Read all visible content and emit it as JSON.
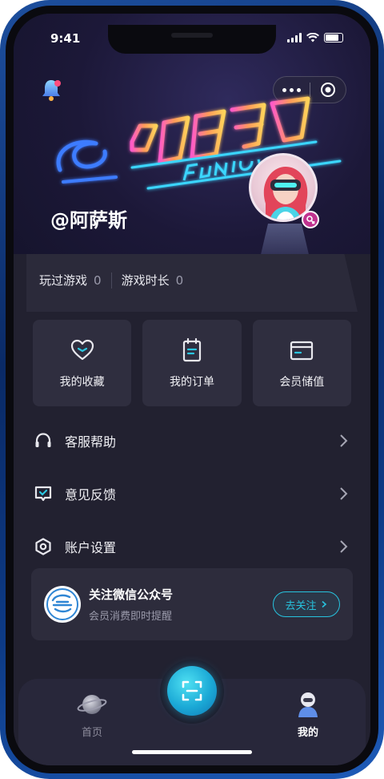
{
  "status_bar": {
    "time": "9:41"
  },
  "profile": {
    "username": "@阿萨斯"
  },
  "stats": [
    {
      "label": "玩过游戏",
      "value": "0"
    },
    {
      "label": "游戏时长",
      "value": "0"
    }
  ],
  "quick_actions": [
    {
      "label": "我的收藏",
      "icon": "heart-icon"
    },
    {
      "label": "我的订单",
      "icon": "clipboard-icon"
    },
    {
      "label": "会员储值",
      "icon": "card-icon"
    }
  ],
  "menu": [
    {
      "label": "客服帮助",
      "icon": "headset-icon"
    },
    {
      "label": "意见反馈",
      "icon": "feedback-icon"
    },
    {
      "label": "账户设置",
      "icon": "settings-icon"
    }
  ],
  "follow": {
    "title": "关注微信公众号",
    "subtitle": "会员消费即时提醒",
    "button": "去关注"
  },
  "tabbar": {
    "home": "首页",
    "mine": "我的"
  },
  "colors": {
    "accent": "#27c3de",
    "panel": "#222130",
    "card": "#2f2e3f"
  }
}
